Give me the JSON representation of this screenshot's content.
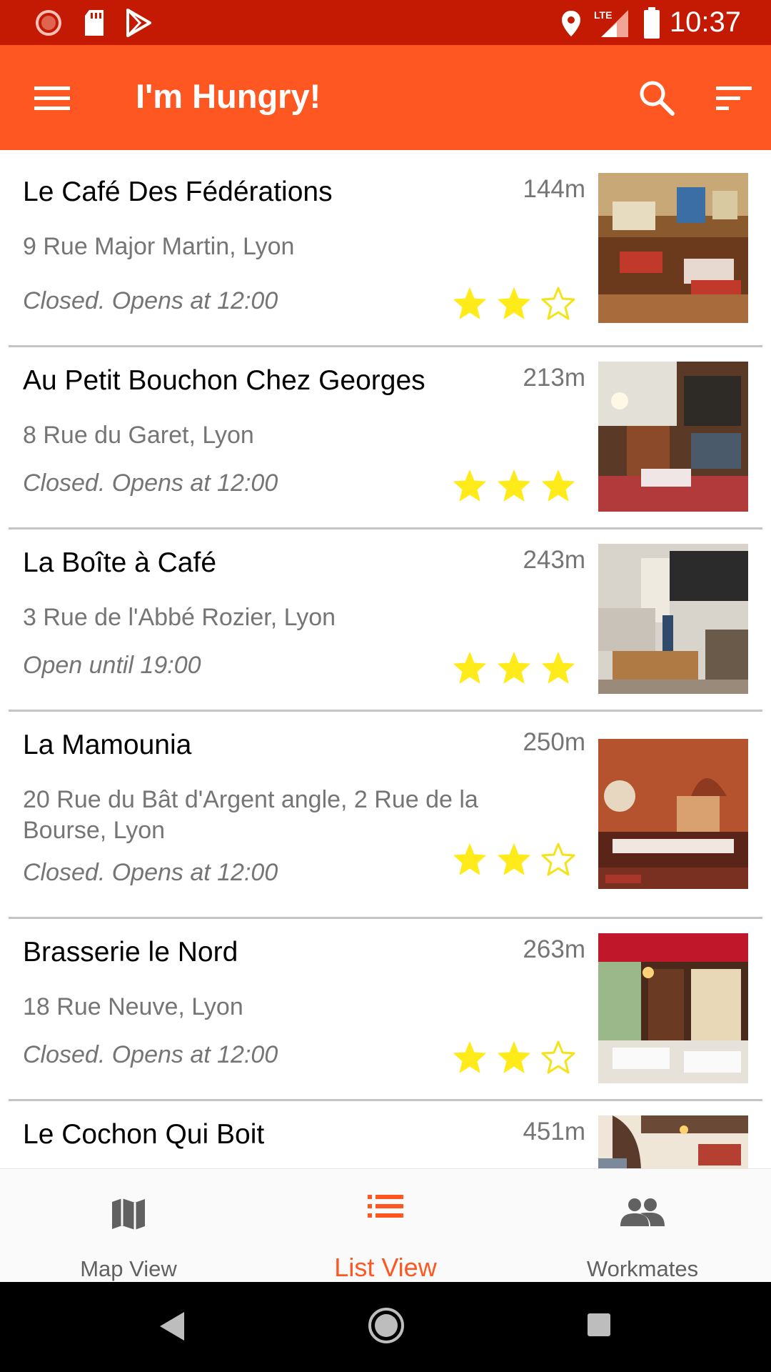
{
  "status_bar": {
    "time": "10:37",
    "network": "LTE",
    "left_icons": [
      "record-icon",
      "sd-card-icon",
      "play-store-icon"
    ],
    "right_icons": [
      "location-icon",
      "signal-icon",
      "battery-icon"
    ]
  },
  "app_bar": {
    "title": "I'm Hungry!",
    "menu_icon": "menu-icon",
    "search_icon": "search-icon",
    "sort_icon": "sort-icon",
    "color": "#FF5722"
  },
  "restaurants": [
    {
      "name": "Le Café Des Fédérations",
      "distance": "144m",
      "address": "9 Rue Major Martin, Lyon",
      "hours": "Closed. Opens at 12:00",
      "stars": 2
    },
    {
      "name": "Au Petit Bouchon Chez Georges",
      "distance": "213m",
      "address": "8 Rue du Garet, Lyon",
      "hours": "Closed. Opens at 12:00",
      "stars": 3
    },
    {
      "name": "La Boîte à Café",
      "distance": "243m",
      "address": "3 Rue de l'Abbé Rozier, Lyon",
      "hours": "Open until 19:00",
      "stars": 3
    },
    {
      "name": "La Mamounia",
      "distance": "250m",
      "address": "20 Rue du Bât d'Argent angle, 2 Rue de la Bourse, Lyon",
      "hours": "Closed. Opens at 12:00",
      "stars": 2
    },
    {
      "name": "Brasserie le Nord",
      "distance": "263m",
      "address": "18 Rue Neuve, Lyon",
      "hours": "Closed. Opens at 12:00",
      "stars": 2
    },
    {
      "name": "Le Cochon Qui Boit",
      "distance": "451m",
      "address": "",
      "hours": "",
      "stars": null
    }
  ],
  "bottom_nav": {
    "tabs": [
      {
        "label": "Map View",
        "icon": "map-icon",
        "active": false
      },
      {
        "label": "List View",
        "icon": "list-icon",
        "active": true
      },
      {
        "label": "Workmates",
        "icon": "people-icon",
        "active": false
      }
    ],
    "active_color": "#FF5722"
  },
  "system_nav": {
    "icons": [
      "back-icon",
      "home-icon",
      "recents-icon"
    ]
  }
}
